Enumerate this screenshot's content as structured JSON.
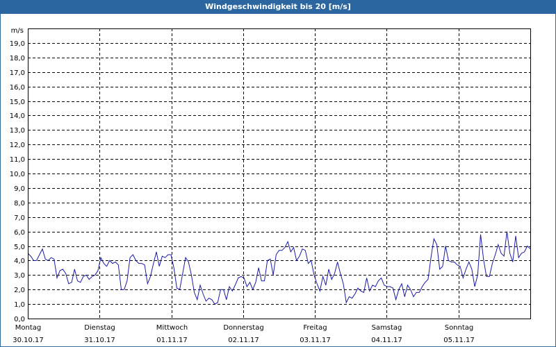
{
  "window": {
    "title": "Windgeschwindigkeit bis 20 [m/s]"
  },
  "chart_data": {
    "type": "line",
    "title": "Windgeschwindigkeit bis 20 [m/s]",
    "ylabel": "m/s",
    "ylim": [
      0,
      20
    ],
    "yticks": [
      "0,0",
      "1,0",
      "2,0",
      "3,0",
      "4,0",
      "5,0",
      "6,0",
      "7,0",
      "8,0",
      "9,0",
      "10,0",
      "11,0",
      "12,0",
      "13,0",
      "14,0",
      "15,0",
      "16,0",
      "17,0",
      "18,0",
      "19,0"
    ],
    "xlim": [
      0,
      7
    ],
    "days": [
      {
        "name": "Montag",
        "date": "30.10.17"
      },
      {
        "name": "Dienstag",
        "date": "31.10.17"
      },
      {
        "name": "Mittwoch",
        "date": "01.11.17"
      },
      {
        "name": "Donnerstag",
        "date": "02.11.17"
      },
      {
        "name": "Freitag",
        "date": "03.11.17"
      },
      {
        "name": "Samstag",
        "date": "04.11.17"
      },
      {
        "name": "Sonntag",
        "date": "05.11.17"
      }
    ],
    "grid": true,
    "series": [
      {
        "color": "#1a1aa6",
        "values": [
          4.5,
          4.3,
          4.0,
          4.0,
          4.4,
          4.8,
          4.1,
          4.0,
          4.2,
          4.1,
          2.8,
          3.3,
          3.4,
          3.1,
          2.4,
          2.5,
          3.4,
          2.6,
          2.5,
          2.9,
          3.0,
          2.7,
          2.9,
          3.0,
          3.3,
          4.2,
          3.8,
          3.6,
          4.0,
          3.8,
          3.9,
          3.7,
          2.0,
          2.0,
          2.6,
          4.2,
          4.4,
          4.0,
          3.8,
          3.8,
          3.7,
          2.4,
          2.9,
          3.8,
          4.6,
          3.6,
          4.3,
          4.2,
          4.4,
          4.4,
          3.5,
          2.1,
          2.0,
          3.1,
          4.2,
          3.9,
          3.0,
          1.8,
          1.3,
          2.3,
          1.7,
          1.2,
          1.4,
          1.3,
          1.0,
          1.1,
          2.0,
          2.0,
          1.3,
          2.2,
          1.9,
          2.3,
          2.8,
          2.9,
          2.8,
          2.2,
          2.5,
          2.0,
          2.5,
          3.5,
          2.6,
          2.6,
          4.0,
          4.1,
          3.0,
          4.4,
          4.7,
          4.7,
          4.9,
          5.3,
          4.6,
          4.9,
          4.0,
          4.3,
          4.8,
          4.7,
          3.8,
          4.0,
          3.0,
          2.4,
          1.9,
          2.9,
          2.3,
          3.4,
          2.7,
          3.1,
          3.9,
          3.1,
          2.4,
          1.1,
          1.5,
          1.4,
          1.7,
          2.1,
          1.9,
          1.8,
          2.8,
          1.9,
          2.3,
          2.2,
          2.6,
          2.8,
          2.3,
          2.2,
          2.2,
          2.1,
          1.3,
          2.0,
          2.4,
          1.5,
          2.3,
          2.0,
          1.5,
          1.8,
          1.8,
          2.2,
          2.5,
          2.7,
          4.2,
          5.5,
          5.1,
          3.4,
          3.6,
          5.0,
          4.0,
          3.9,
          3.9,
          3.7,
          3.6,
          2.8,
          3.4,
          3.9,
          3.4,
          2.2,
          3.0,
          5.8,
          4.1,
          2.9,
          2.9,
          3.8,
          4.4,
          5.1,
          4.5,
          4.3,
          6.0,
          4.5,
          3.9,
          5.7,
          4.2,
          4.5,
          4.6,
          5.0,
          4.8
        ]
      }
    ]
  }
}
